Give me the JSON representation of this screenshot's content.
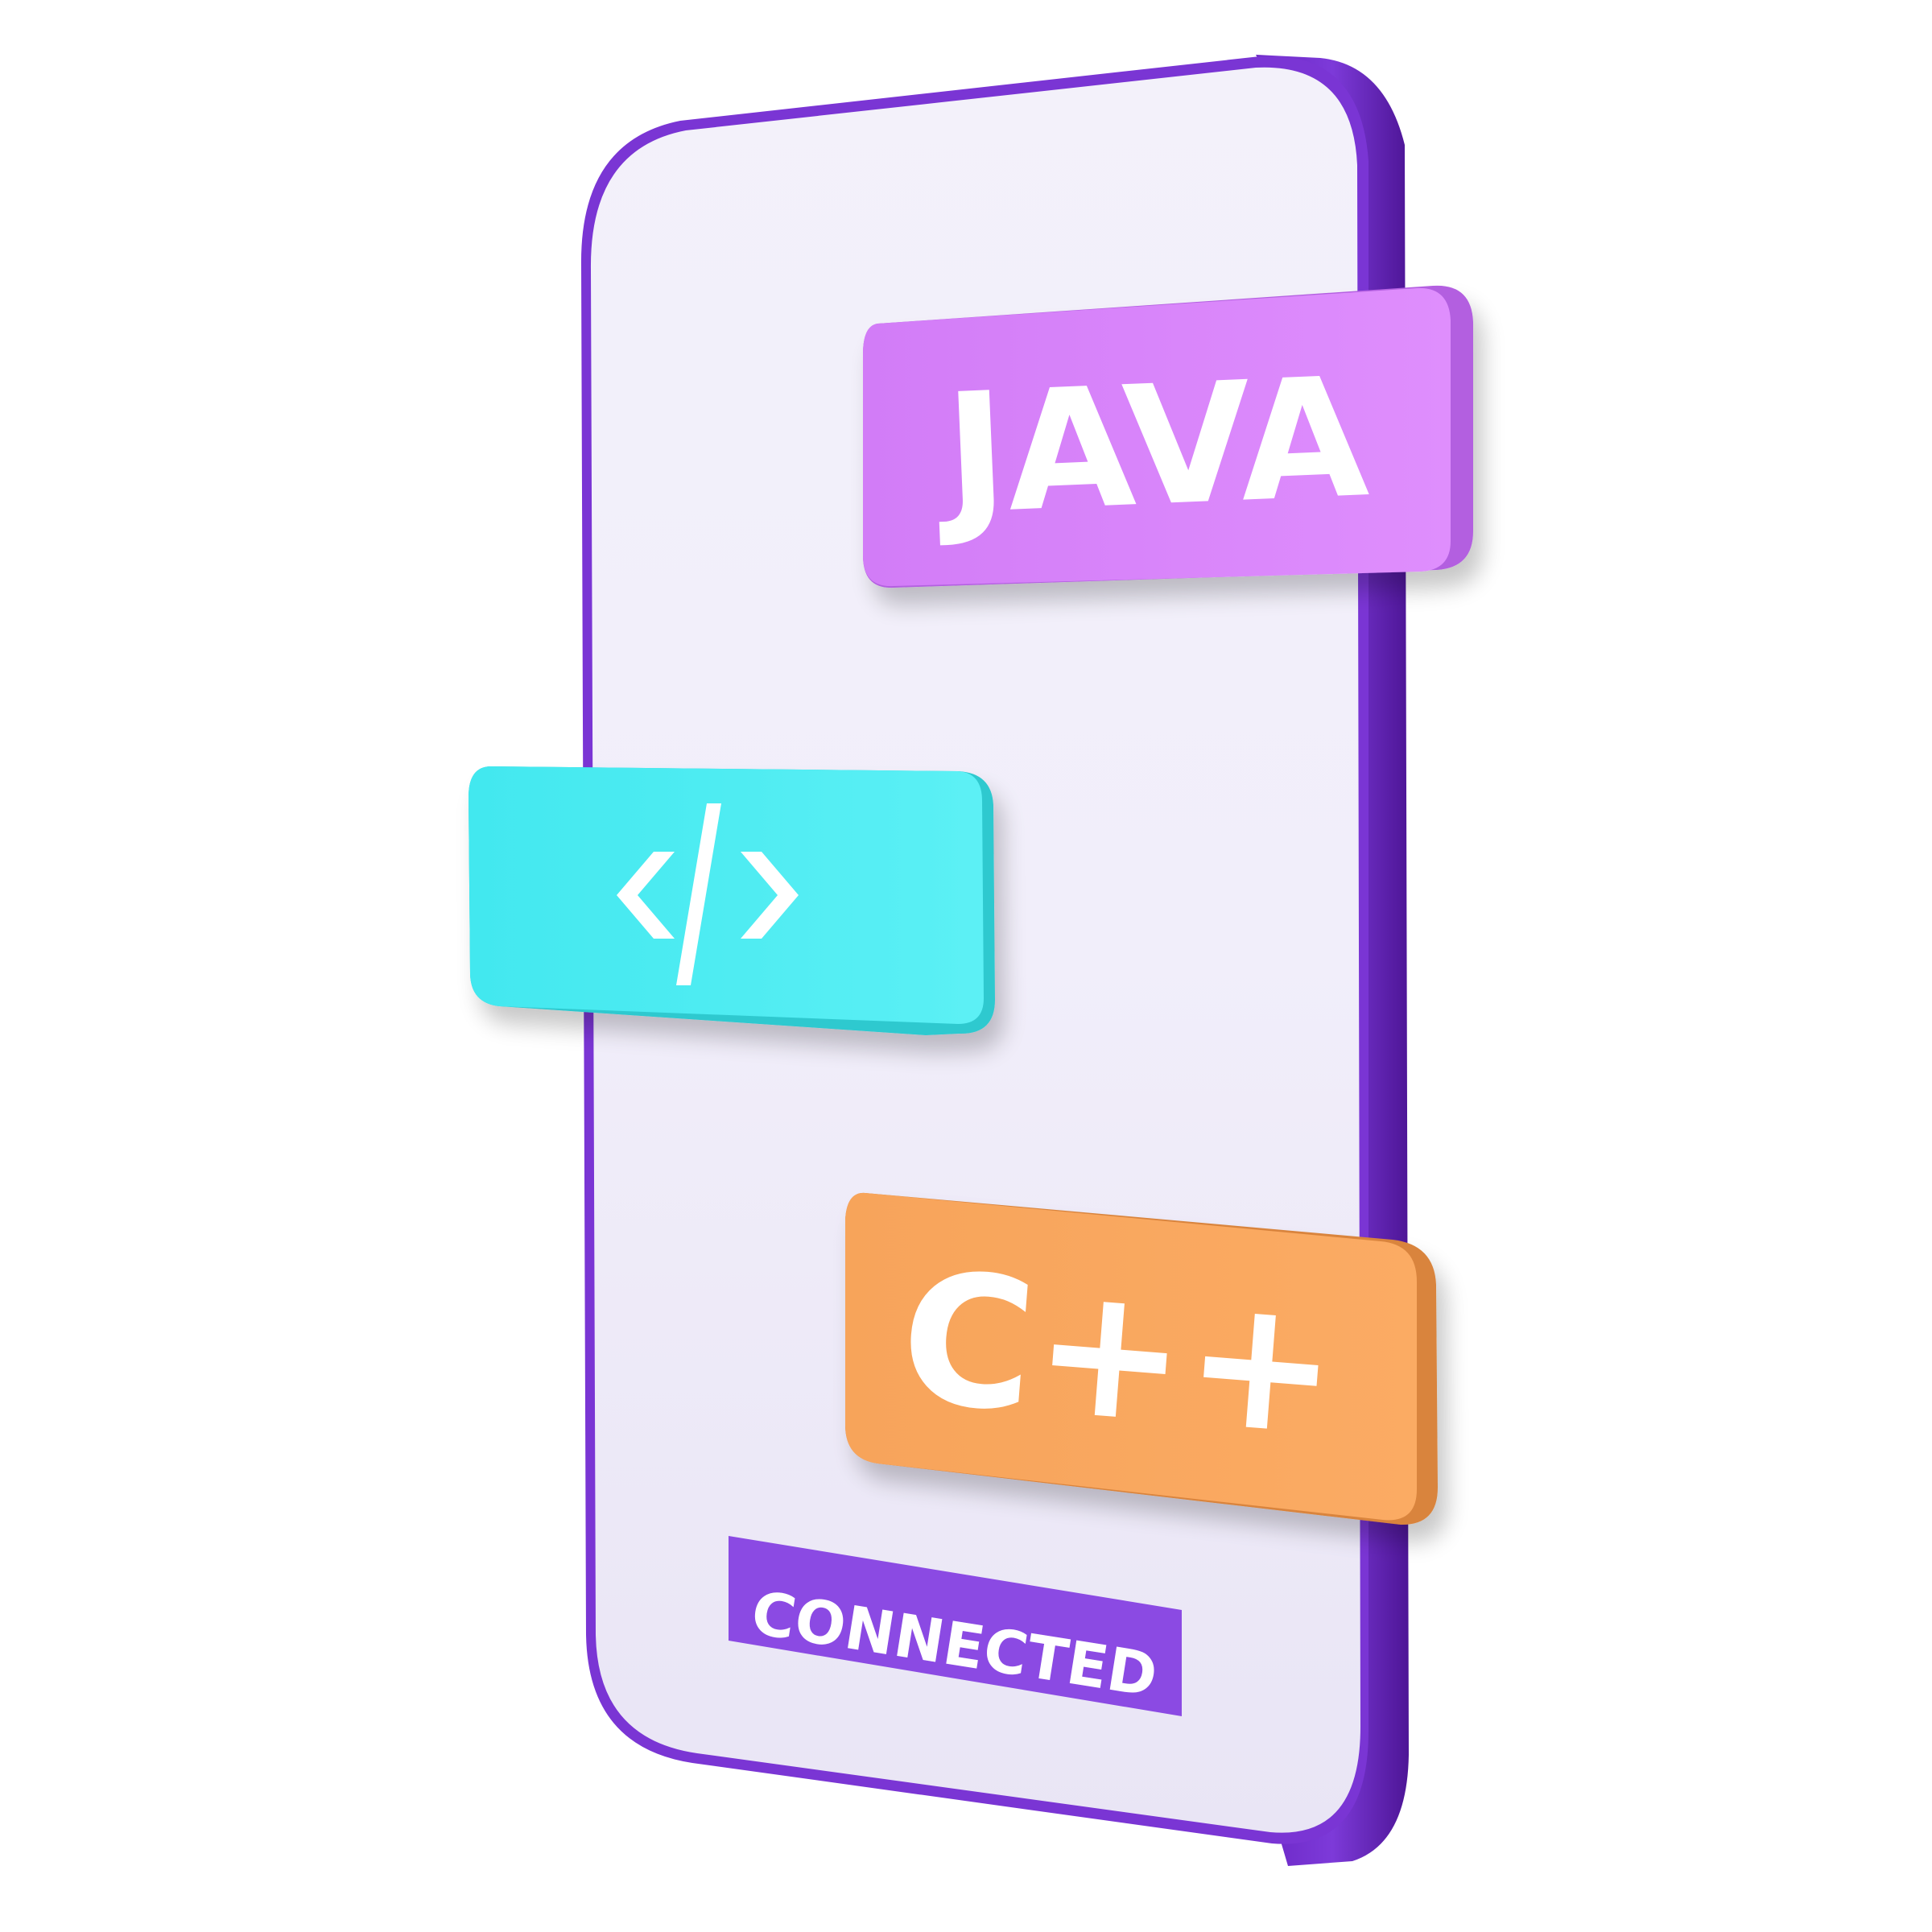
{
  "illustration": {
    "cards": {
      "java": {
        "label": "JAVA",
        "color": "#d887fb"
      },
      "code": {
        "icon": "code-brackets-icon",
        "color": "#49eaef"
      },
      "cpp": {
        "label": "C++",
        "color": "#f9a65c"
      }
    },
    "status_badge": {
      "label": "CONNECTED",
      "color": "#8b4ae3"
    },
    "phone": {
      "frame_color": "#7a35d4",
      "screen_color": "#f1eff9"
    }
  }
}
